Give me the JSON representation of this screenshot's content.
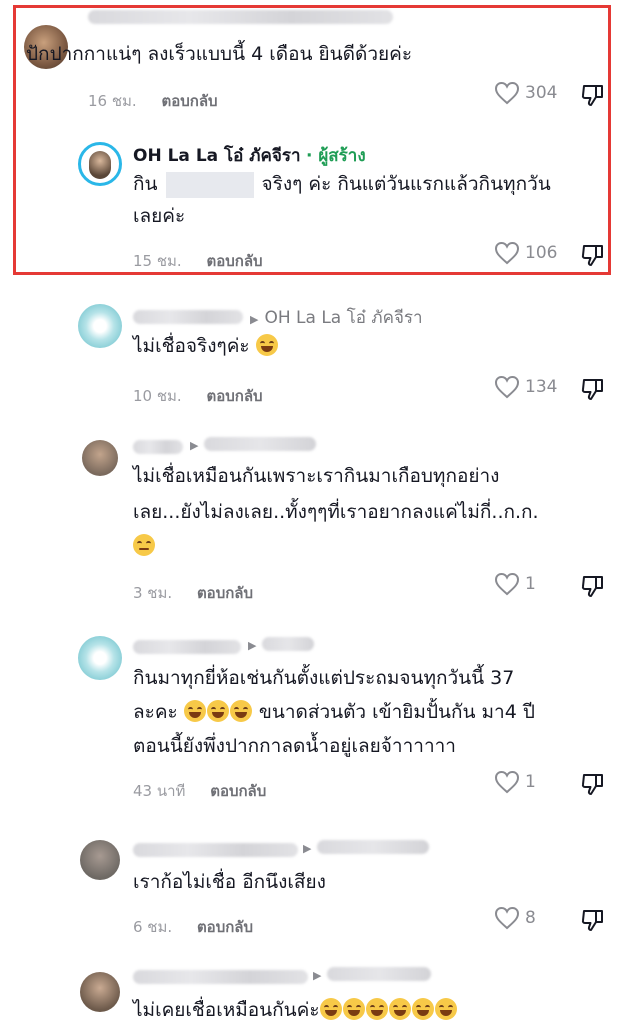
{
  "comments": [
    {
      "text": "ปักปากกาแน่ๆ ลงเร็วแบบนี้ 4 เดือน ยินดีด้วยค่ะ",
      "time": "16 ชม.",
      "reply_label": "ตอบกลับ",
      "likes": "304"
    },
    {
      "creator_name": "OH La La โอ๋ ภัคจีรา",
      "creator_tag": "· ผู้สร้าง",
      "text_before": "กิน",
      "text_after": "จริงๆ ค่ะ กินแต่วันแรกแล้วกินทุกวัน",
      "text_line2": "เลยค่ะ",
      "time": "15 ชม.",
      "reply_label": "ตอบกลับ",
      "likes": "106"
    },
    {
      "reply_to": "OH La La โอ๋ ภัคจีรา",
      "text": "ไม่เชื่อจริงๆค่ะ",
      "time": "10 ชม.",
      "reply_label": "ตอบกลับ",
      "likes": "134"
    },
    {
      "line1": "ไม่เชื่อเหมือนกันเพราะเรากินมาเกือบทุกอย่าง",
      "line2": "เลย...ยังไม่ลงเลย..ทั้งๆๆที่เราอยากลงแค่ไม่กี่..ก.ก.",
      "time": "3 ชม.",
      "reply_label": "ตอบกลับ",
      "likes": "1"
    },
    {
      "line1": "กินมาทุกยี่ห้อเช่นกันตั้งแต่ประถมจนทุกวันนี้ 37",
      "line2_a": "ละคะ",
      "line2_b": "ขนาดส่วนตัว เข้ายิมปั้นกัน มา4 ปี",
      "line3": "ตอนนี้ยังพึ่งปากกาลดน้ำอยู่เลยจ้าาาาาา",
      "time": "43 นาที",
      "reply_label": "ตอบกลับ",
      "likes": "1"
    },
    {
      "text": "เราก้อไม่เชื่อ อีกนึงเสียง",
      "time": "6 ชม.",
      "reply_label": "ตอบกลับ",
      "likes": "8"
    },
    {
      "text": "ไม่เคยเชื่อเหมือนกันค่ะ"
    }
  ],
  "colors": {
    "highlight": "#e53935",
    "creator_tag": "#1f9d55"
  }
}
